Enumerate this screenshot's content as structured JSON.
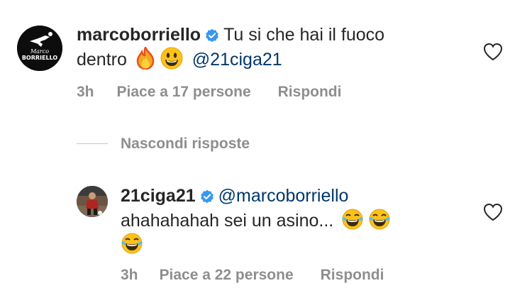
{
  "comment": {
    "username": "marcoborriello",
    "text_part1": "Tu si che hai il fuoco",
    "text_part2": "dentro",
    "mention": "@21ciga21",
    "time": "3h",
    "likes": "Piace a 17 persone",
    "reply": "Rispondi",
    "avatar_text_top": "Marco",
    "avatar_text_bottom": "BORRIELLO"
  },
  "thread": {
    "toggle": "Nascondi risposte"
  },
  "reply": {
    "username": "21ciga21",
    "mention": "@marcoborriello",
    "text": "ahahahahah sei un asino...",
    "time": "3h",
    "likes": "Piace a 22 persone",
    "reply": "Rispondi"
  },
  "colors": {
    "verified": "#3897f0",
    "mention": "#00376b",
    "meta": "#8e8e8e"
  },
  "icons": [
    "verified-badge-icon",
    "heart-icon",
    "fire-emoji",
    "smile-emoji",
    "laughing-tears-emoji"
  ]
}
